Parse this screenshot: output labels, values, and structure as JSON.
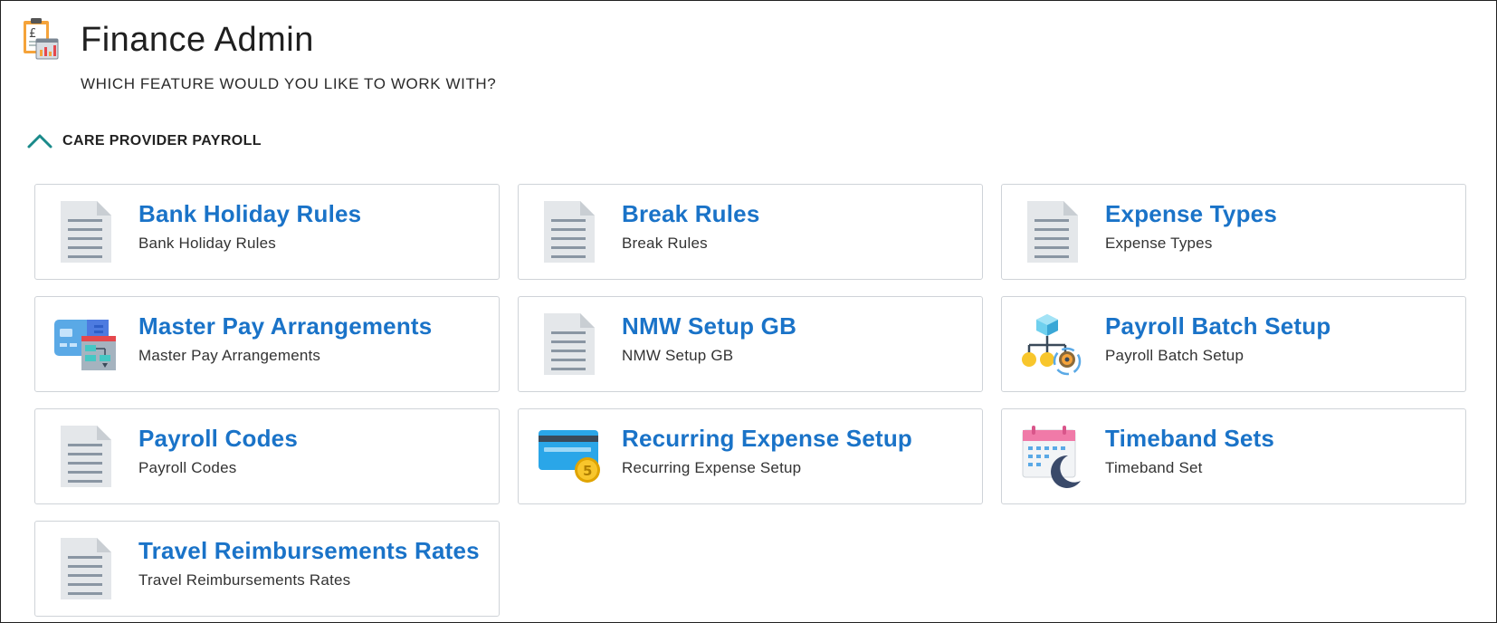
{
  "app": {
    "title": "Finance Admin",
    "subtitle": "WHICH FEATURE WOULD YOU LIKE TO WORK WITH?",
    "icon": "finance-clipboard-icon"
  },
  "section": {
    "label": "CARE PROVIDER PAYROLL",
    "expanded": true,
    "toggle_icon": "chevron-up-icon",
    "accent": "#1a8a8a"
  },
  "colors": {
    "title_blue": "#1a73c8",
    "card_border": "#cfd3d8"
  },
  "features": [
    {
      "title": "Bank Holiday Rules",
      "description": "Bank Holiday Rules",
      "icon": "document-icon"
    },
    {
      "title": "Break Rules",
      "description": "Break Rules",
      "icon": "document-icon"
    },
    {
      "title": "Expense Types",
      "description": "Expense Types",
      "icon": "document-icon"
    },
    {
      "title": "Master Pay Arrangements",
      "description": "Master Pay Arrangements",
      "icon": "card-hierarchy-icon"
    },
    {
      "title": "NMW Setup GB",
      "description": "NMW Setup GB",
      "icon": "document-icon"
    },
    {
      "title": "Payroll Batch Setup",
      "description": "Payroll Batch Setup",
      "icon": "batch-network-gear-icon"
    },
    {
      "title": "Payroll Codes",
      "description": "Payroll Codes",
      "icon": "document-icon"
    },
    {
      "title": "Recurring Expense Setup",
      "description": "Recurring Expense Setup",
      "icon": "credit-card-coin-icon"
    },
    {
      "title": "Timeband Sets",
      "description": "Timeband Set",
      "icon": "calendar-moon-icon"
    },
    {
      "title": "Travel Reimbursements Rates",
      "description": "Travel Reimbursements Rates",
      "icon": "document-icon"
    }
  ]
}
